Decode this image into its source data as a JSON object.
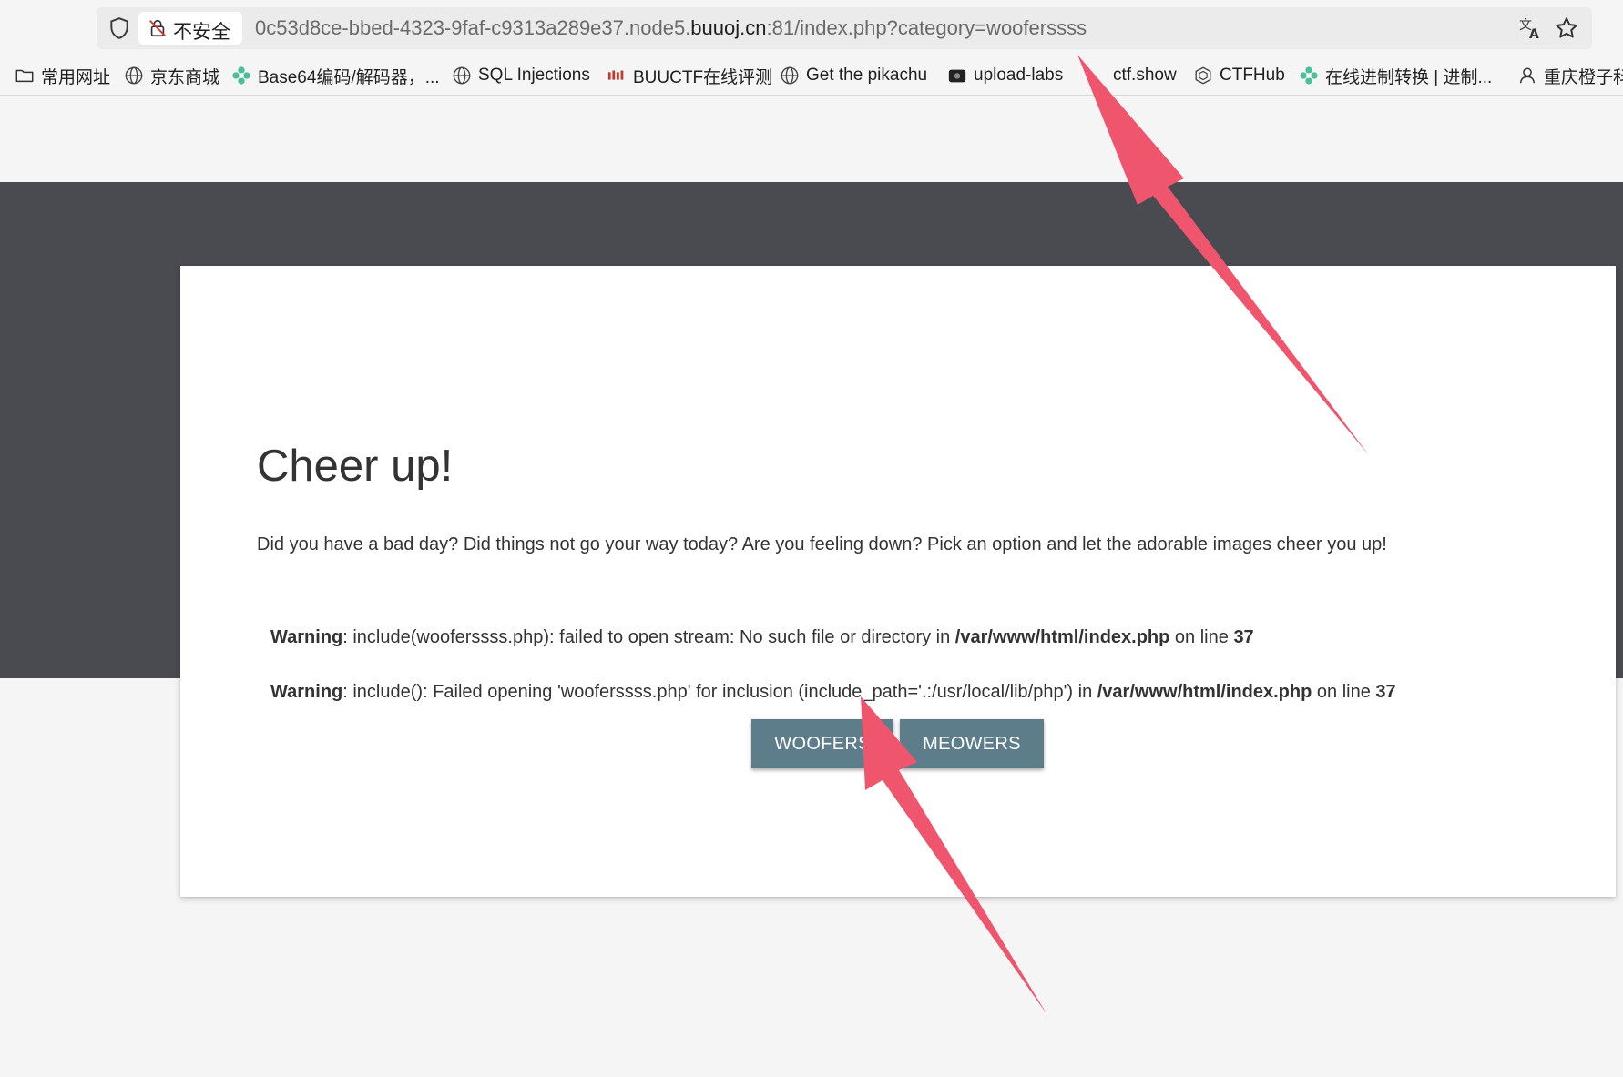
{
  "browser": {
    "security_label": "不安全",
    "url_prefix": "0c53d8ce-bbed-4323-9faf-c9313a289e37.node5.",
    "url_host": "buuoj.cn",
    "url_suffix": ":81/index.php?category=wooferssss",
    "icons": [
      "shield-icon",
      "lock-off-icon",
      "translate-icon",
      "star-icon"
    ]
  },
  "bookmarks": [
    {
      "label": "常用网址",
      "icon": "folder-icon"
    },
    {
      "label": "京东商城",
      "icon": "globe-icon"
    },
    {
      "label": "Base64编码/解码器，...",
      "icon": "flower-icon"
    },
    {
      "label": "SQL Injections",
      "icon": "globe-icon"
    },
    {
      "label": "BUUCTF在线评测",
      "icon": "buuctf-icon"
    },
    {
      "label": "Get the pikachu",
      "icon": "globe-icon"
    },
    {
      "label": "upload-labs",
      "icon": "upload-icon"
    },
    {
      "label": "ctf.show",
      "icon": "ctfshow-icon"
    },
    {
      "label": "CTFHub",
      "icon": "cube-icon"
    },
    {
      "label": "在线进制转换 | 进制...",
      "icon": "flower-icon"
    },
    {
      "label": "重庆橙子科",
      "icon": "person-icon"
    }
  ],
  "page": {
    "title": "Cheer up!",
    "intro": "Did you have a bad day? Did things not go your way today? Are you feeling down? Pick an option and let the adorable images cheer you up!",
    "warning1": {
      "label": "Warning",
      "text": ": include(wooferssss.php): failed to open stream: No such file or directory in ",
      "path": "/var/www/html/index.php",
      "on_line": " on line ",
      "line": "37"
    },
    "warning2": {
      "label": "Warning",
      "text": ": include(): Failed opening 'wooferssss.php' for inclusion (include_path='.:/usr/local/lib/php') in ",
      "path": "/var/www/html/index.php",
      "on_line": " on line ",
      "line": "37"
    },
    "buttons": {
      "woofers": "WOOFERS",
      "meowers": "MEOWERS"
    }
  },
  "colors": {
    "band": "#4a4b50",
    "button": "#5e7d8a",
    "annotation_arrow": "#f0556e"
  }
}
